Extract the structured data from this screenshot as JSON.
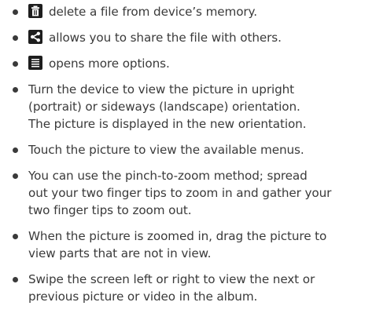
{
  "items": [
    {
      "icon": "trash-icon",
      "text": "delete a file from device’s memory."
    },
    {
      "icon": "share-icon",
      "text": "allows you to share the file with others."
    },
    {
      "icon": "menu-icon",
      "text": "opens more options."
    },
    {
      "text_lines": [
        "Turn the device to view the picture in upright",
        "(portrait) or sideways (landscape) orientation.",
        "The picture is displayed in the new orientation."
      ]
    },
    {
      "text_lines": [
        "Touch the picture to view the available menus."
      ]
    },
    {
      "text_lines": [
        "You can use the pinch-to-zoom method; spread",
        "out your two finger tips to zoom in and gather your",
        "two finger tips to zoom out."
      ]
    },
    {
      "text_lines": [
        "When the picture is zoomed in, drag the picture to",
        "view parts that are not in view."
      ]
    },
    {
      "text_lines": [
        "Swipe the screen left or right to view the next or",
        "previous picture or video in the album."
      ]
    }
  ]
}
